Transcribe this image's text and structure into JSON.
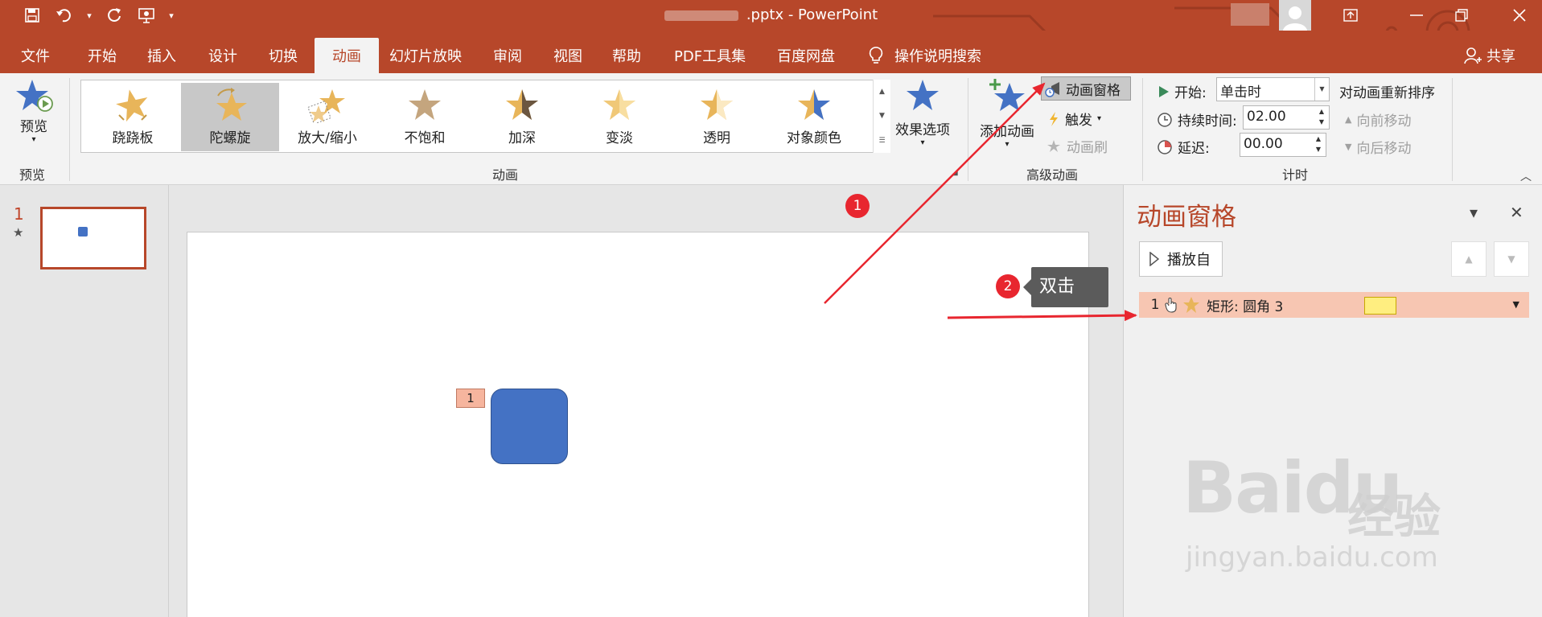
{
  "window": {
    "title_suffix": ".pptx  -  PowerPoint"
  },
  "tabs": [
    "文件",
    "开始",
    "插入",
    "设计",
    "切换",
    "动画",
    "幻灯片放映",
    "审阅",
    "视图",
    "帮助",
    "PDF工具集",
    "百度网盘"
  ],
  "active_tab": "动画",
  "tell_me": "操作说明搜索",
  "share": "共享",
  "ribbon": {
    "preview": {
      "label": "预览",
      "group": "预览"
    },
    "animation_group": "动画",
    "gallery": [
      "跷跷板",
      "陀螺旋",
      "放大/缩小",
      "不饱和",
      "加深",
      "变淡",
      "透明",
      "对象颜色"
    ],
    "gallery_selected": "陀螺旋",
    "effect_options": "效果选项",
    "advanced": {
      "add_animation": "添加动画",
      "animation_pane": "动画窗格",
      "trigger": "触发",
      "painter": "动画刷",
      "group": "高级动画"
    },
    "timing": {
      "start_label": "开始:",
      "start_value": "单击时",
      "duration_label": "持续时间:",
      "duration_value": "02.00",
      "delay_label": "延迟:",
      "delay_value": "00.00",
      "reorder": "对动画重新排序",
      "move_earlier": "向前移动",
      "move_later": "向后移动",
      "group": "计时"
    }
  },
  "slides": [
    {
      "number": "1"
    }
  ],
  "slide": {
    "anim_tag": "1"
  },
  "pane": {
    "title": "动画窗格",
    "play_from": "播放自",
    "items": [
      {
        "order": "1",
        "name": "矩形: 圆角 3"
      }
    ]
  },
  "annotations": {
    "badge1": "1",
    "badge2": "2",
    "tooltip": "双击"
  },
  "watermark": {
    "logo": "Baidu",
    "cn": "经验",
    "url": "jingyan.baidu.com"
  },
  "colors": {
    "accent": "#b7472a",
    "shape": "#4472c4",
    "annotation": "#e8262f"
  }
}
